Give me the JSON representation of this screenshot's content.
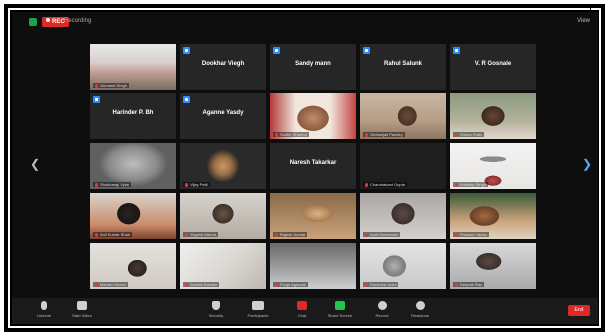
{
  "topbar": {
    "rec_label": "REC",
    "status": "Recording",
    "view_label": "View"
  },
  "name_tiles": [
    {
      "name": "Gurmeet Singh",
      "caption": ""
    },
    {
      "name": "Dookhar Viegh",
      "caption": ""
    },
    {
      "name": "Sandy mann",
      "caption": ""
    },
    {
      "name": "Rahul Salunk",
      "caption": ""
    },
    {
      "name": "V. R Gosnale",
      "caption": ""
    },
    {
      "name": "Harinder P. Bh",
      "caption": ""
    },
    {
      "name": "Aganne Yasdy",
      "caption": ""
    },
    {
      "name": "Naresh Takarkar",
      "caption": ""
    }
  ],
  "video_tiles": [
    {
      "caption": "Sudhir Sharma"
    },
    {
      "caption": "Geetanjali Pandey"
    },
    {
      "caption": "Sriram Patel"
    },
    {
      "caption": "Shubhangi Vyas"
    },
    {
      "caption": "Vijay Patil"
    },
    {
      "caption": "Chandrakant Gupta"
    },
    {
      "caption": "Kuldeep Singh"
    },
    {
      "caption": "Anil Kumar Shah"
    },
    {
      "caption": "Yogesh Mishra"
    },
    {
      "caption": "Rajesh Kumar"
    },
    {
      "caption": "Aarti Deshmukh"
    },
    {
      "caption": "Prakash Yadav"
    },
    {
      "caption": "Manish Verma"
    },
    {
      "caption": "Suresh Kamble"
    },
    {
      "caption": "Pooja Agarwal"
    },
    {
      "caption": "Ravindra Joshi"
    },
    {
      "caption": "Deepak Rao"
    },
    {
      "caption": "Ganesh Naik"
    }
  ],
  "toolbar": {
    "unmute": "Unmute",
    "start_video": "Start Video",
    "security": "Security",
    "participants": "Participants",
    "participants_count": "44",
    "chat": "Chat",
    "share_screen": "Share Screen",
    "record": "Record",
    "reactions": "Reactions",
    "end": "End"
  },
  "colors": {
    "accent_blue": "#2d8cff",
    "rec_red": "#e02828",
    "active_speaker": "#9fbf2a",
    "bg": "#0e0e0e"
  }
}
